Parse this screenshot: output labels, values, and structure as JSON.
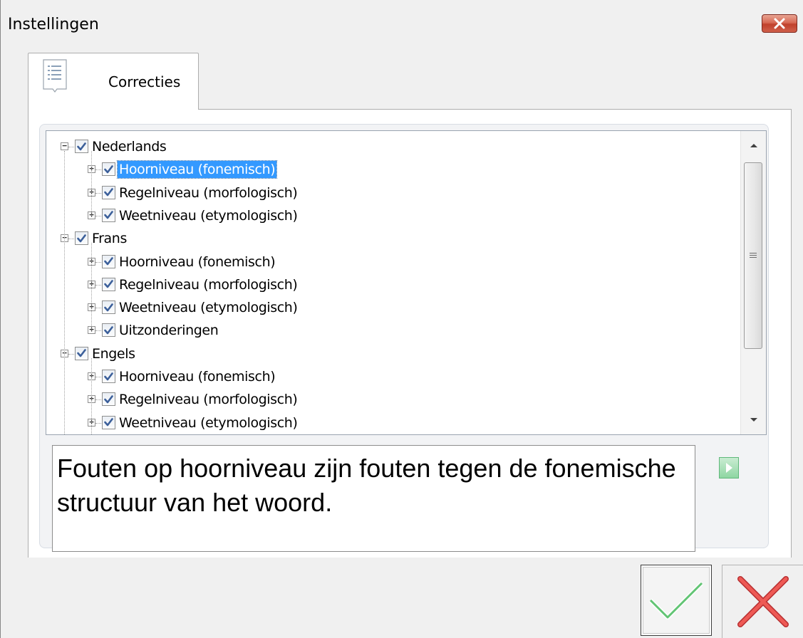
{
  "window": {
    "title": "Instellingen"
  },
  "tabs": [
    {
      "label": "Correcties",
      "icon": "list-document-icon",
      "active": true
    }
  ],
  "tree": {
    "nodes": [
      {
        "label": "Nederlands",
        "level": 0,
        "checked": true,
        "expanded": true
      },
      {
        "label": "Hoorniveau (fonemisch)",
        "level": 1,
        "checked": true,
        "expanded": false,
        "selected": true
      },
      {
        "label": "Regelniveau (morfologisch)",
        "level": 1,
        "checked": true,
        "expanded": false
      },
      {
        "label": "Weetniveau (etymologisch)",
        "level": 1,
        "checked": true,
        "expanded": false
      },
      {
        "label": "Frans",
        "level": 0,
        "checked": true,
        "expanded": true
      },
      {
        "label": "Hoorniveau (fonemisch)",
        "level": 1,
        "checked": true,
        "expanded": false
      },
      {
        "label": "Regelniveau (morfologisch)",
        "level": 1,
        "checked": true,
        "expanded": false
      },
      {
        "label": "Weetniveau (etymologisch)",
        "level": 1,
        "checked": true,
        "expanded": false
      },
      {
        "label": "Uitzonderingen",
        "level": 1,
        "checked": true,
        "expanded": false
      },
      {
        "label": "Engels",
        "level": 0,
        "checked": true,
        "expanded": true
      },
      {
        "label": "Hoorniveau (fonemisch)",
        "level": 1,
        "checked": true,
        "expanded": false
      },
      {
        "label": "Regelniveau (morfologisch)",
        "level": 1,
        "checked": true,
        "expanded": false
      },
      {
        "label": "Weetniveau (etymologisch)",
        "level": 1,
        "checked": true,
        "expanded": false
      }
    ]
  },
  "description": {
    "text": "Fouten op hoorniveau zijn fouten tegen de fonemische structuur van het woord."
  },
  "buttons": {
    "ok_icon": "checkmark-icon",
    "cancel_icon": "cross-icon",
    "play_icon": "play-icon",
    "close_icon": "close-icon"
  },
  "colors": {
    "selection": "#3399ff",
    "ok_green": "#5cc36e",
    "cancel_red": "#e8484a",
    "close_red": "#c7432e"
  }
}
